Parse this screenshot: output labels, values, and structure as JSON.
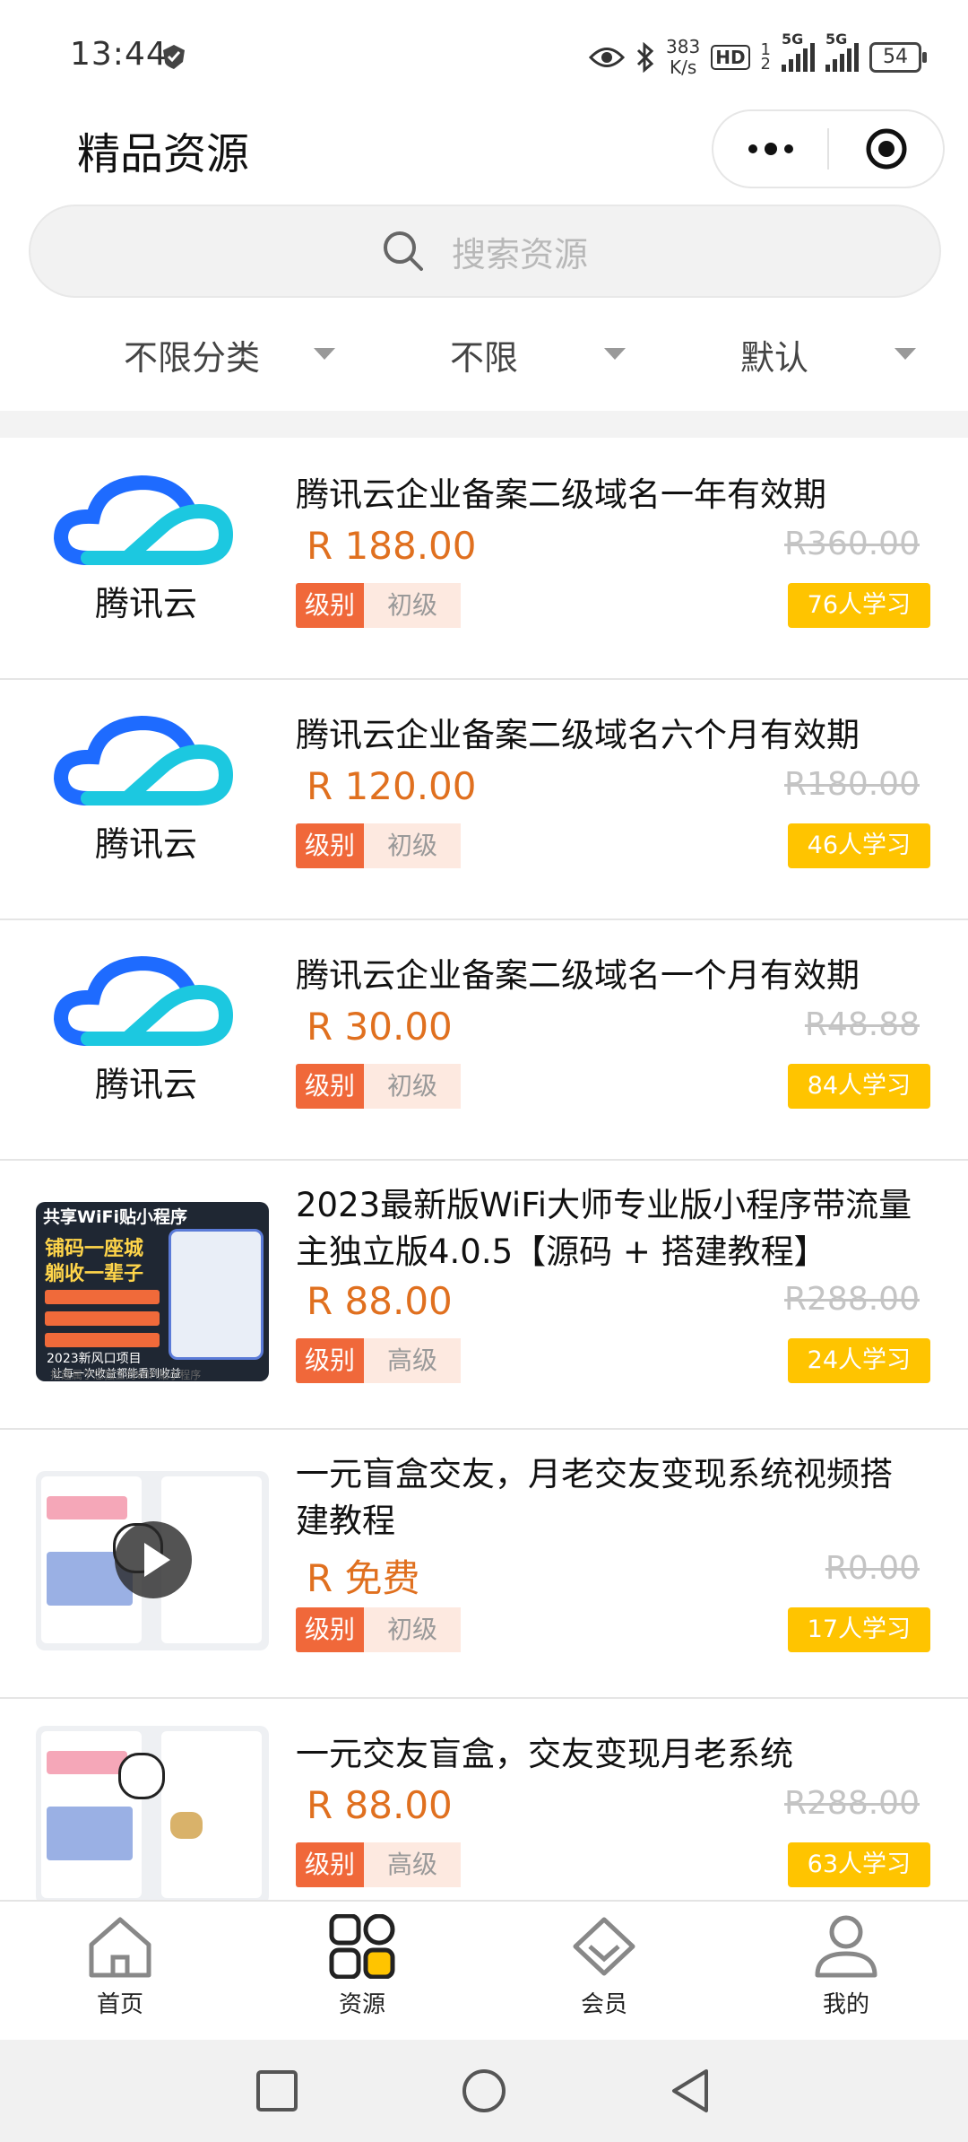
{
  "status_bar": {
    "time": "13:44",
    "net_speed_value": "383",
    "net_speed_unit": "K/s",
    "hd": "HD",
    "sim1": "1",
    "sim2": "2",
    "net1": "5G",
    "net2": "5G",
    "battery": "54"
  },
  "header": {
    "title": "精品资源",
    "more_icon": "more-dots-icon",
    "close_icon": "target-circle-icon"
  },
  "search": {
    "placeholder": "搜索资源"
  },
  "filters": [
    {
      "label": "不限分类"
    },
    {
      "label": "不限"
    },
    {
      "label": "默认"
    }
  ],
  "items": [
    {
      "title": "腾讯云企业备案二级域名一年有效期",
      "price": "R 188.00",
      "old_price": "R360.00",
      "level_key": "级别",
      "level": "初级",
      "learners": "76人学习",
      "thumb": "tencent",
      "thumb_text": "腾讯云"
    },
    {
      "title": "腾讯云企业备案二级域名六个月有效期",
      "price": "R 120.00",
      "old_price": "R180.00",
      "level_key": "级别",
      "level": "初级",
      "learners": "46人学习",
      "thumb": "tencent",
      "thumb_text": "腾讯云"
    },
    {
      "title": "腾讯云企业备案二级域名一个月有效期",
      "price": "R 30.00",
      "old_price": "R48.88",
      "level_key": "级别",
      "level": "初级",
      "learners": "84人学习",
      "thumb": "tencent",
      "thumb_text": "腾讯云"
    },
    {
      "title": "2023最新版WiFi大师专业版小程序带流量主独立版4.0.5【源码 + 搭建教程】",
      "price": "R 88.00",
      "old_price": "R288.00",
      "level_key": "级别",
      "level": "高级",
      "learners": "24人学习",
      "thumb": "wifi",
      "thumb_lines": [
        "共享WiFi贴小程序",
        "铺码一座城",
        "躺收一辈子",
        "2023新风口项目",
        "让每一次收益都能看到收益",
        "搭建属于您独立的WiFi贴小程序"
      ]
    },
    {
      "title": "一元盲盒交友，月老交友变现系统视频搭建教程",
      "price": "R 免费",
      "old_price": "R0.00",
      "level_key": "级别",
      "level": "初级",
      "learners": "17人学习",
      "thumb": "video"
    },
    {
      "title": "一元交友盲盒，交友变现月老系统",
      "price": "R 88.00",
      "old_price": "R288.00",
      "level_key": "级别",
      "level": "高级",
      "learners": "63人学习",
      "thumb": "app"
    }
  ],
  "tabbar": [
    {
      "label": "首页",
      "icon": "home-icon",
      "active": false
    },
    {
      "label": "资源",
      "icon": "grid-icon",
      "active": true
    },
    {
      "label": "会员",
      "icon": "diamond-icon",
      "active": false
    },
    {
      "label": "我的",
      "icon": "user-icon",
      "active": false
    }
  ],
  "colors": {
    "price": "#e0701f",
    "level_key_bg": "#f0683a",
    "level_val_bg": "#fde9e0",
    "learners_bg": "#ffc400",
    "tab_active": "#ffc400",
    "tencent_blue": "#1e6bff",
    "tencent_cyan": "#1cc8e0"
  }
}
